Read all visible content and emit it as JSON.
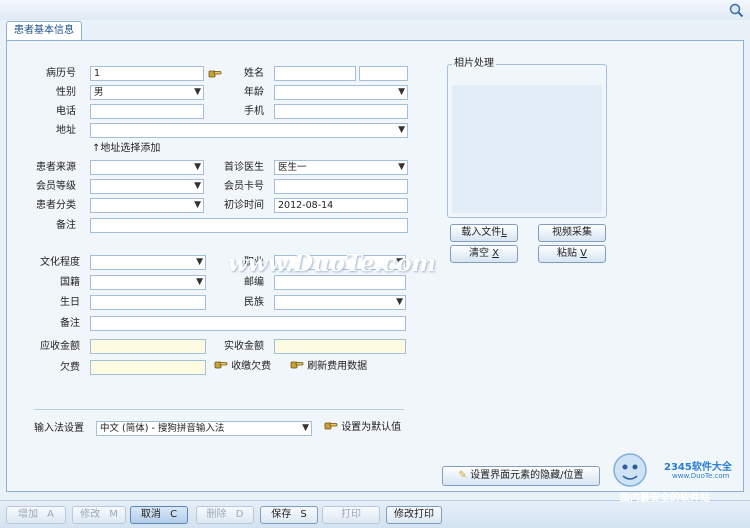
{
  "tab": {
    "title": "患者基本信息"
  },
  "form": {
    "record_no": {
      "label": "病历号",
      "value": "1"
    },
    "name": {
      "label": "姓名"
    },
    "gender": {
      "label": "性别",
      "value": "男"
    },
    "age": {
      "label": "年龄"
    },
    "phone": {
      "label": "电话"
    },
    "mobile": {
      "label": "手机"
    },
    "address": {
      "label": "地址",
      "add_link": "地址选择添加"
    },
    "source": {
      "label": "患者来源"
    },
    "first_doctor": {
      "label": "首诊医生",
      "value": "医生一"
    },
    "member_level": {
      "label": "会员等级"
    },
    "member_card": {
      "label": "会员卡号"
    },
    "category": {
      "label": "患者分类"
    },
    "first_visit": {
      "label": "初诊时间",
      "value": "2012-08-14"
    },
    "remark1": {
      "label": "备注"
    },
    "education": {
      "label": "文化程度"
    },
    "occupation": {
      "label": "职业"
    },
    "nationality": {
      "label": "国籍"
    },
    "postcode": {
      "label": "邮编"
    },
    "birthday": {
      "label": "生日"
    },
    "ethnicity": {
      "label": "民族"
    },
    "remark2": {
      "label": "备注"
    },
    "receivable": {
      "label": "应收金额"
    },
    "received": {
      "label": "实收金额"
    },
    "arrears": {
      "label": "欠费"
    }
  },
  "links": {
    "collect_arrears": "收缴欠费",
    "refresh_fees": "刷新费用数据",
    "set_default": "设置为默认值"
  },
  "ime": {
    "label": "输入法设置",
    "value": "中文 (简体) - 搜狗拼音输入法"
  },
  "photo": {
    "title": "相片处理",
    "load_file": {
      "label": "载入文件",
      "key": "L"
    },
    "video_capture": {
      "label": "视频采集"
    },
    "clear": {
      "label": "清空",
      "key": "X"
    },
    "paste": {
      "label": "粘贴",
      "key": "V"
    }
  },
  "settings_button": "设置界面元素的隐藏/位置",
  "toolbar": [
    {
      "label": "增加",
      "key": "A",
      "state": "disabled"
    },
    {
      "label": "修改",
      "key": "M",
      "state": "disabled"
    },
    {
      "label": "取消",
      "key": "C",
      "state": "active"
    },
    {
      "label": "删除",
      "key": "D",
      "state": "disabled"
    },
    {
      "label": "保存",
      "key": "S",
      "state": "normal"
    },
    {
      "label": "打印",
      "key": "",
      "state": "disabled"
    },
    {
      "label": "修改打印",
      "key": "",
      "state": "normal"
    }
  ],
  "watermark": {
    "brand": "2345软件大全",
    "site": "www.DuoTe.com",
    "slogan": "国内最安全的软件站",
    "duote": "www.DuoTe.com"
  },
  "colors": {
    "accent": "#1c4d8c",
    "panel_border": "#8fb0d3",
    "yellow_field": "#fefbe3"
  }
}
